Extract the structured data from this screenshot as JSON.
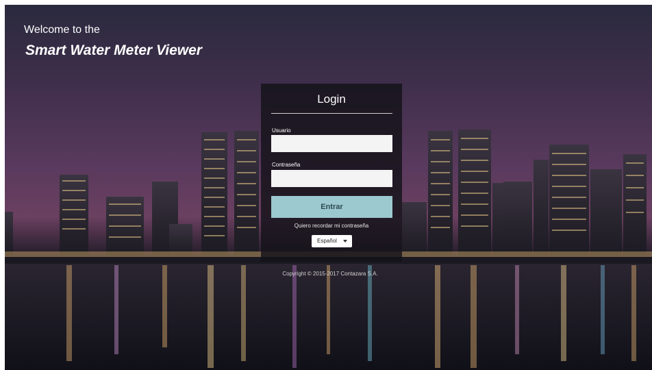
{
  "header": {
    "welcome": "Welcome to the",
    "app_name": "Smart Water Meter Viewer"
  },
  "login": {
    "title": "Login",
    "username_label": "Usuario",
    "username_value": "",
    "password_label": "Contraseña",
    "password_value": "",
    "submit_label": "Entrar",
    "forgot_link": "Quiero recordar mi contraseña",
    "language_selected": "Español"
  },
  "footer": {
    "copyright": "Copyright © 2015-2017 Contazara S.A."
  },
  "colors": {
    "submit_button": "#9cc8cf",
    "panel_background": "#141218"
  }
}
